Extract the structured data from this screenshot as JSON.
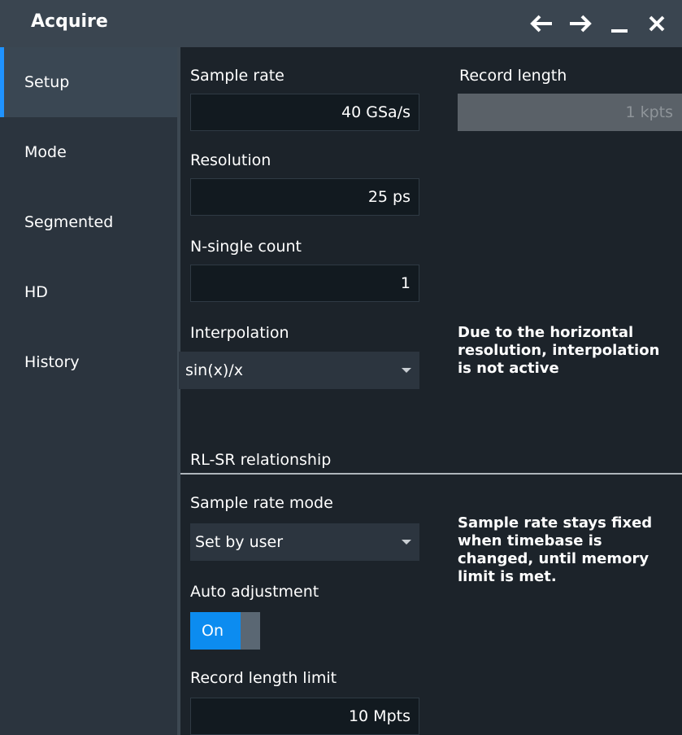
{
  "window": {
    "title": "Acquire"
  },
  "sidebar": {
    "items": [
      {
        "label": "Setup",
        "active": true
      },
      {
        "label": "Mode"
      },
      {
        "label": "Segmented"
      },
      {
        "label": "HD"
      },
      {
        "label": "History"
      }
    ]
  },
  "setup": {
    "sample_rate": {
      "label": "Sample rate",
      "value": "40 GSa/s"
    },
    "record_length": {
      "label": "Record length",
      "value": "1 kpts",
      "disabled": true
    },
    "resolution": {
      "label": "Resolution",
      "value": "25 ps"
    },
    "n_single_count": {
      "label": "N-single count",
      "value": "1"
    },
    "interpolation": {
      "label": "Interpolation",
      "value": "sin(x)/x"
    },
    "interpolation_note": "Due to the horizontal\nresolution, interpolation\nis not active",
    "rl_sr": {
      "title": "RL-SR relationship",
      "sample_rate_mode": {
        "label": "Sample rate mode",
        "value": "Set by user"
      },
      "mode_note": "Sample rate stays fixed\nwhen timebase is\nchanged, until memory\nlimit is met.",
      "auto_adjustment": {
        "label": "Auto adjustment",
        "state": "On"
      },
      "record_length_limit": {
        "label": "Record length limit",
        "value": "10 Mpts"
      }
    }
  },
  "colors": {
    "accent": "#1f93ff",
    "toggle_on": "#0c8cf0",
    "titlebar": "#3a4550",
    "background": "#1c232a"
  }
}
